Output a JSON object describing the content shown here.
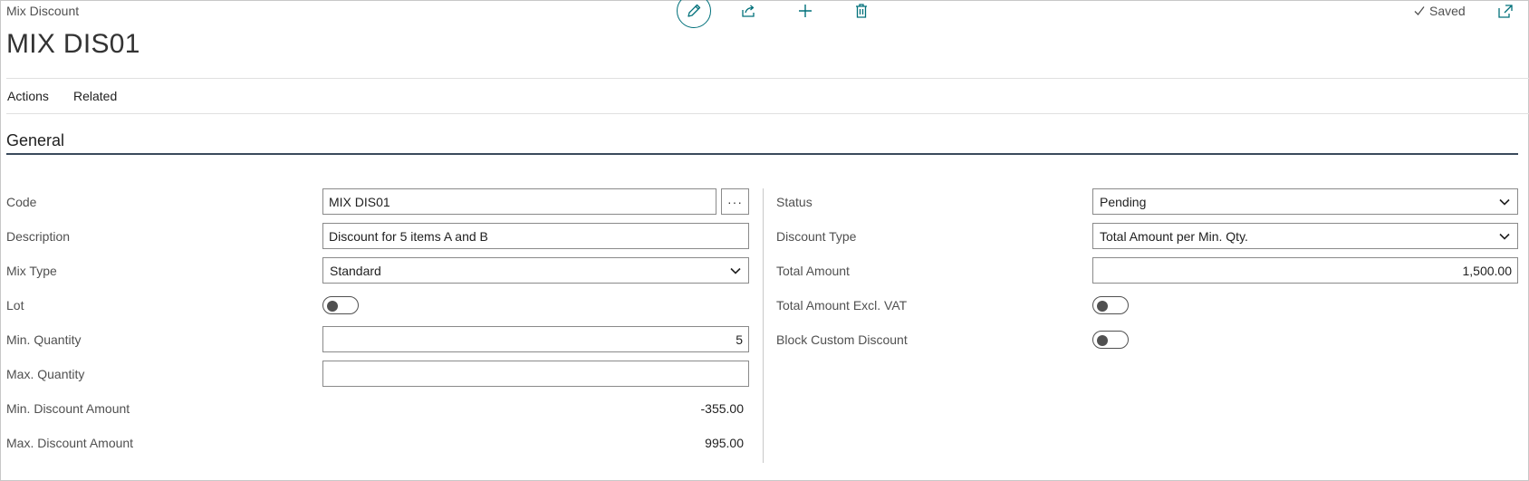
{
  "page": {
    "caption": "Mix Discount",
    "title": "MIX DIS01",
    "saved_status": "Saved"
  },
  "toolbar": {
    "edit_icon": "pencil-icon",
    "share_icon": "share-icon",
    "new_icon": "plus-icon",
    "delete_icon": "trash-icon",
    "accent_color": "#00707a"
  },
  "menu": {
    "actions": "Actions",
    "related": "Related"
  },
  "section": {
    "title": "General"
  },
  "left": {
    "code": {
      "label": "Code",
      "value": "MIX DIS01",
      "lookup": "···"
    },
    "description": {
      "label": "Description",
      "value": "Discount for 5 items A and B"
    },
    "mix_type": {
      "label": "Mix Type",
      "value": "Standard"
    },
    "lot": {
      "label": "Lot",
      "on": false
    },
    "min_quantity": {
      "label": "Min. Quantity",
      "value": "5"
    },
    "max_quantity": {
      "label": "Max. Quantity",
      "value": ""
    },
    "min_discount_amount": {
      "label": "Min. Discount Amount",
      "value": "-355.00"
    },
    "max_discount_amount": {
      "label": "Max. Discount Amount",
      "value": "995.00"
    }
  },
  "right": {
    "status": {
      "label": "Status",
      "value": "Pending"
    },
    "discount_type": {
      "label": "Discount Type",
      "value": "Total Amount per Min. Qty."
    },
    "total_amount": {
      "label": "Total Amount",
      "value": "1,500.00"
    },
    "total_amount_excl_vat": {
      "label": "Total Amount Excl. VAT",
      "on": false
    },
    "block_custom_discount": {
      "label": "Block Custom Discount",
      "on": false
    }
  }
}
